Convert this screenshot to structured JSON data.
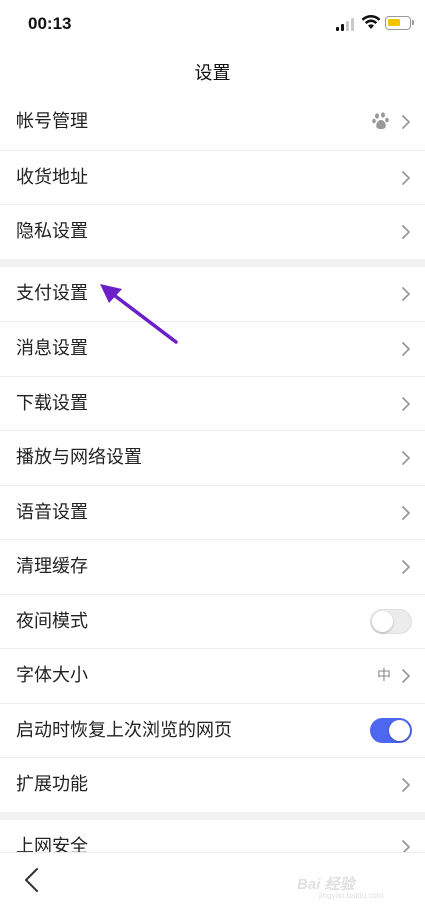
{
  "status_bar": {
    "time": "00:13",
    "icons": [
      "signal-icon",
      "wifi-icon",
      "battery-icon"
    ]
  },
  "header": {
    "title": "设置"
  },
  "group1": [
    {
      "label": "帐号管理",
      "trailing_icon": "baidu-paw-icon"
    },
    {
      "label": "收货地址"
    },
    {
      "label": "隐私设置"
    }
  ],
  "group2": [
    {
      "label": "支付设置"
    },
    {
      "label": "消息设置"
    },
    {
      "label": "下载设置"
    },
    {
      "label": "播放与网络设置"
    },
    {
      "label": "语音设置"
    },
    {
      "label": "清理缓存"
    },
    {
      "label": "夜间模式",
      "toggle": false
    },
    {
      "label": "字体大小",
      "value": "中"
    },
    {
      "label": "启动时恢复上次浏览的网页",
      "toggle": true
    },
    {
      "label": "扩展功能"
    }
  ],
  "group3": [
    {
      "label": "上网安全"
    }
  ],
  "bottom_bar": {
    "back_icon": "back-arrow-icon"
  },
  "watermark": {
    "text": "Bai 经验",
    "sub": "jingyan.baidu.com"
  },
  "annotation": {
    "icon": "purple-arrow-annotation",
    "color": "#6a1fc8"
  },
  "colors": {
    "toggle_on": "#4d67f0",
    "separator": "#f2f2f2",
    "battery": "#f5c400"
  }
}
